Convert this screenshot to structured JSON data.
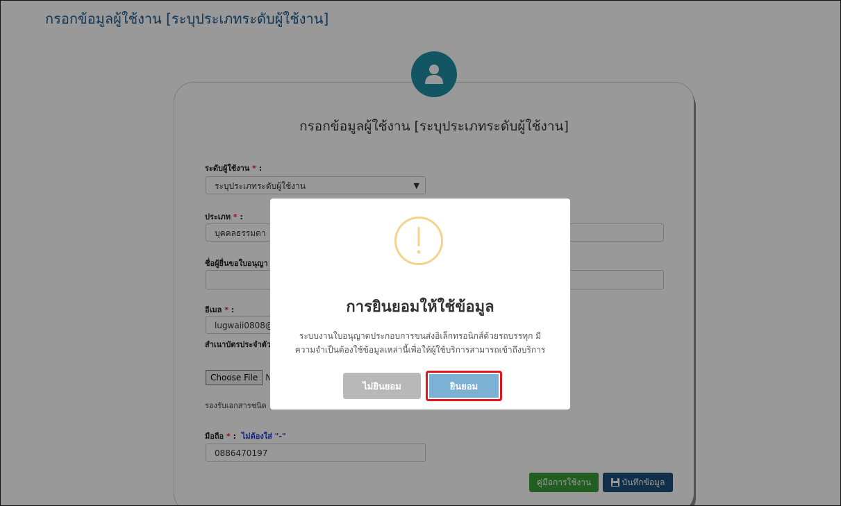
{
  "page": {
    "title": "กรอกข้อมูลผู้ใช้งาน [ระบุประเภทระดับผู้ใช้งาน]"
  },
  "form": {
    "title": "กรอกข้อมูลผู้ใช้งาน [ระบุประเภทระดับผู้ใช้งาน]",
    "user_level": {
      "label": "ระดับผู้ใช้งาน",
      "required": "*",
      "colon": ":",
      "value": "ระบุประเภทระดับผู้ใช้งาน"
    },
    "type": {
      "label": "ประเภท",
      "required": "*",
      "colon": ":",
      "value": "บุคคลธรรมดา"
    },
    "applicant": {
      "label": "ชื่อผู้ยื่นขอใบอนุญา"
    },
    "email": {
      "label": "อีเมล",
      "required": "*",
      "colon": ":",
      "value": "lugwaii0808@g"
    },
    "id_copy": {
      "label": "สำเนาบัตรประจำตัว"
    },
    "choose_file": "Choose File",
    "file_status": "N",
    "accepted_types": "รองรับเอกสารชนิด",
    "mobile": {
      "label": "มือถือ",
      "required": "*",
      "colon": ":",
      "note": "ไม่ต้องใส่ \"-\"",
      "value": "0886470197"
    },
    "manual_button": "คู่มือการใช้งาน",
    "save_button": "บันทึกข้อมูล"
  },
  "modal": {
    "title": "การยินยอมให้ใช้ข้อมูล",
    "message_line1": "ระบบงานใบอนุญาตประกอบการขนส่งอิเล็กทรอนิกส์ด้วยรถบรรทุก มี",
    "message_line2": "ความจำเป็นต้องใช้ข้อมูลเหล่านี้เพื่อให้ผู้ใช้บริการสามารถเข้าถึงบริการ",
    "decline_button": "ไม่ยินยอม",
    "accept_button": "ยินยอม"
  },
  "colors": {
    "accent": "#1f8fa6",
    "accept": "#7cb1d6",
    "decline": "#b8b8b8",
    "highlight": "#e0161e",
    "manual": "#3a9b3a",
    "save": "#1e4f7c",
    "warning": "#f8d18a"
  },
  "icons": [
    "user-icon",
    "warning-icon",
    "chevron-down-icon",
    "floppy-disk-icon"
  ]
}
